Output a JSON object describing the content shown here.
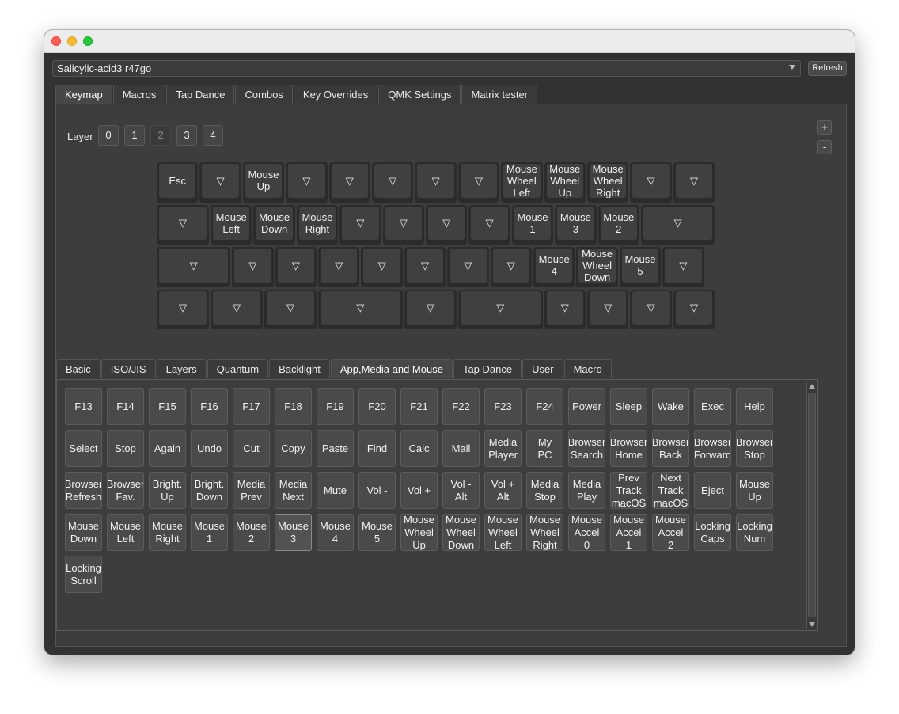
{
  "device": {
    "selected": "Salicylic-acid3 r47go",
    "refresh_label": "Refresh"
  },
  "main_tabs": [
    "Keymap",
    "Macros",
    "Tap Dance",
    "Combos",
    "Key Overrides",
    "QMK Settings",
    "Matrix tester"
  ],
  "main_tab_active": "Keymap",
  "layer": {
    "label": "Layer",
    "buttons": [
      "0",
      "1",
      "2",
      "3",
      "4"
    ],
    "active": "2"
  },
  "zoom": {
    "plus": "+",
    "minus": "-"
  },
  "keyboard": {
    "rows": [
      [
        "Esc",
        "▽",
        "Mouse\nUp",
        "▽",
        "▽",
        "▽",
        "▽",
        "▽",
        "Mouse\nWheel\nLeft",
        "Mouse\nWheel\nUp",
        "Mouse\nWheel\nRight",
        "▽",
        "▽"
      ],
      [
        "▽",
        "Mouse\nLeft",
        "Mouse\nDown",
        "Mouse\nRight",
        "▽",
        "▽",
        "▽",
        "▽",
        "Mouse\n1",
        "Mouse\n3",
        "Mouse\n2",
        "▽"
      ],
      [
        "▽",
        "▽",
        "▽",
        "▽",
        "▽",
        "▽",
        "▽",
        "▽",
        "Mouse\n4",
        "Mouse\nWheel\nDown",
        "Mouse\n5",
        "▽"
      ],
      [
        "▽",
        "▽",
        "▽",
        "▽",
        "▽",
        "▽",
        "▽",
        "▽",
        "▽",
        "▽"
      ]
    ]
  },
  "keycode_tabs": [
    "Basic",
    "ISO/JIS",
    "Layers",
    "Quantum",
    "Backlight",
    "App,Media and Mouse",
    "Tap Dance",
    "User",
    "Macro"
  ],
  "keycode_tab_active": "App,Media and Mouse",
  "keycodes": [
    "F13",
    "F14",
    "F15",
    "F16",
    "F17",
    "F18",
    "F19",
    "F20",
    "F21",
    "F22",
    "F23",
    "F24",
    "Power",
    "Sleep",
    "Wake",
    "Exec",
    "Help",
    "Select",
    "Stop",
    "Again",
    "Undo",
    "Cut",
    "Copy",
    "Paste",
    "Find",
    "Calc",
    "Mail",
    "Media\nPlayer",
    "My\nPC",
    "Browser\nSearch",
    "Browser\nHome",
    "Browser\nBack",
    "Browser\nForward",
    "Browser\nStop",
    "Browser\nRefresh",
    "Browser\nFav.",
    "Bright.\nUp",
    "Bright.\nDown",
    "Media\nPrev",
    "Media\nNext",
    "Mute",
    "Vol -",
    "Vol +",
    "Vol -\nAlt",
    "Vol +\nAlt",
    "Media\nStop",
    "Media\nPlay",
    "Prev\nTrack\nmacOS",
    "Next\nTrack\nmacOS",
    "Eject",
    "Mouse\nUp",
    "Mouse\nDown",
    "Mouse\nLeft",
    "Mouse\nRight",
    "Mouse\n1",
    "Mouse\n2",
    "Mouse\n3",
    "Mouse\n4",
    "Mouse\n5",
    "Mouse\nWheel\nUp",
    "Mouse\nWheel\nDown",
    "Mouse\nWheel\nLeft",
    "Mouse\nWheel\nRight",
    "Mouse\nAccel\n0",
    "Mouse\nAccel\n1",
    "Mouse\nAccel\n2",
    "Locking\nCaps",
    "Locking\nNum",
    "Locking\nScroll"
  ],
  "keycode_selected": "Mouse\n3",
  "colors": {
    "window_bg": "#323232",
    "panel_bg": "#3d3d3d",
    "key_bg": "#404040",
    "button_bg": "#4a4a4a"
  }
}
